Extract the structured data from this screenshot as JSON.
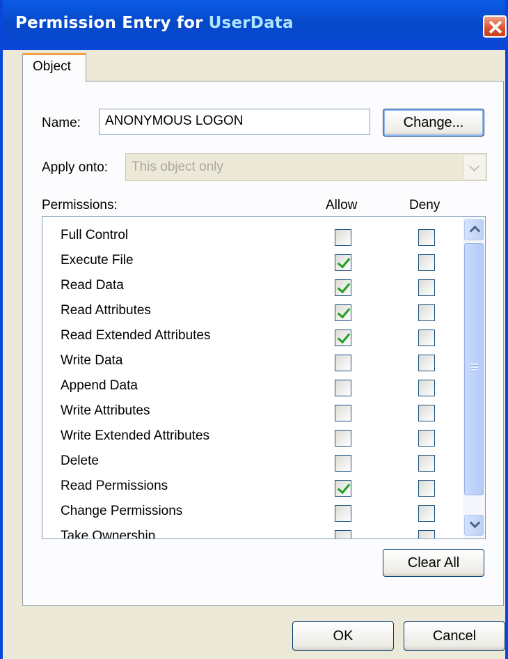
{
  "window": {
    "title_prefix": "Permission Entry for",
    "title_object": "UserData",
    "close_icon": "close-icon"
  },
  "tabs": [
    {
      "label": "Object",
      "active": true
    }
  ],
  "name_row": {
    "label": "Name:",
    "value": "ANONYMOUS LOGON",
    "change_button": "Change..."
  },
  "apply_row": {
    "label": "Apply onto:",
    "value": "This object only",
    "disabled": true
  },
  "permissions": {
    "header_label": "Permissions:",
    "allow_header": "Allow",
    "deny_header": "Deny",
    "rows": [
      {
        "label": "Full Control",
        "allow": false,
        "deny": false
      },
      {
        "label": "Execute File",
        "allow": true,
        "deny": false
      },
      {
        "label": "Read Data",
        "allow": true,
        "deny": false
      },
      {
        "label": "Read Attributes",
        "allow": true,
        "deny": false
      },
      {
        "label": "Read Extended Attributes",
        "allow": true,
        "deny": false
      },
      {
        "label": "Write Data",
        "allow": false,
        "deny": false
      },
      {
        "label": "Append Data",
        "allow": false,
        "deny": false
      },
      {
        "label": "Write Attributes",
        "allow": false,
        "deny": false
      },
      {
        "label": "Write Extended Attributes",
        "allow": false,
        "deny": false
      },
      {
        "label": "Delete",
        "allow": false,
        "deny": false
      },
      {
        "label": "Read Permissions",
        "allow": true,
        "deny": false
      },
      {
        "label": "Change Permissions",
        "allow": false,
        "deny": false
      },
      {
        "label": "Take Ownership",
        "allow": false,
        "deny": false
      }
    ]
  },
  "buttons": {
    "clear_all": "Clear All",
    "ok": "OK",
    "cancel": "Cancel"
  },
  "colors": {
    "title_bar": "#0a46d8",
    "check": "#21a121",
    "dialog_bg": "#ece9d8"
  }
}
